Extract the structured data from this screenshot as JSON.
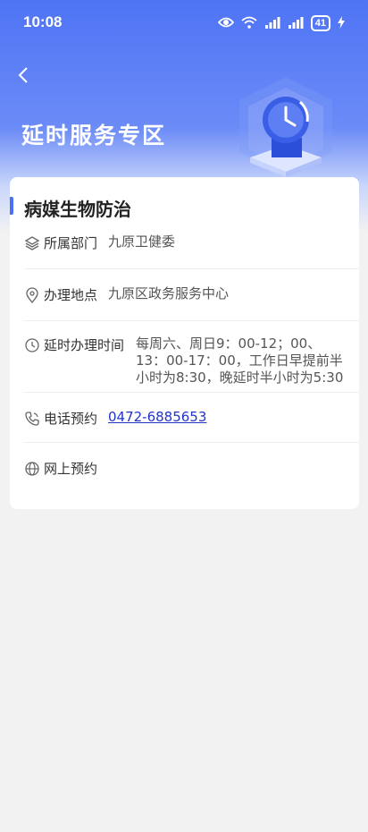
{
  "status_bar": {
    "time": "10:08",
    "battery": "41"
  },
  "header": {
    "title": "延时服务专区"
  },
  "card": {
    "title": "病媒生物防治",
    "rows": [
      {
        "icon": "layers-icon",
        "label": "所属部门",
        "value": "九原卫健委"
      },
      {
        "icon": "location-pin-icon",
        "label": "办理地点",
        "value": "九原区政务服务中心"
      },
      {
        "icon": "clock-icon",
        "label": "延时办理时间",
        "value": "每周六、周日9：00-12；00、13：00-17：00，工作日早提前半小时为8:30，晚延时半小时为5:30"
      },
      {
        "icon": "phone-icon",
        "label": "电话预约",
        "value": "0472-6885653"
      },
      {
        "icon": "globe-icon",
        "label": "网上预约",
        "value": ""
      }
    ]
  },
  "colors": {
    "accent": "#4a72f0",
    "link": "#2234c8",
    "header_blue": "#4f74f5"
  }
}
